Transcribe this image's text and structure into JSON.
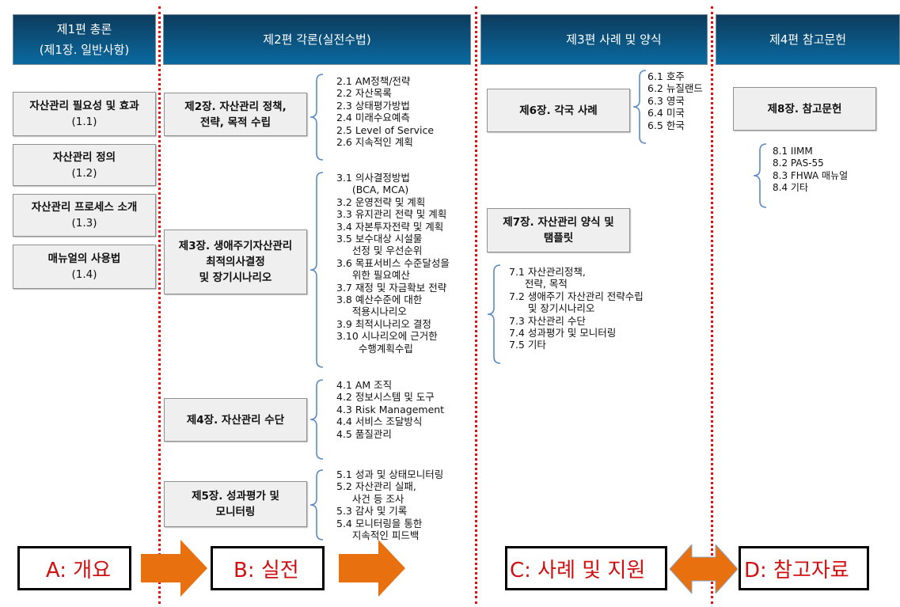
{
  "headers": [
    {
      "line1": "제1편 총론",
      "line2": "(제1장. 일반사항)"
    },
    {
      "line1": "제2편 각론(실전수법)"
    },
    {
      "line1": "제3편 사례 및 양식"
    },
    {
      "line1": "제4편 참고문헌"
    }
  ],
  "part1": {
    "boxes": [
      {
        "title": "자산관리 필요성 및 효과",
        "num": "(1.1)"
      },
      {
        "title": "자산관리 정의",
        "num": "(1.2)"
      },
      {
        "title": "자산관리 프로세스 소개",
        "num": "(1.3)"
      },
      {
        "title": "매뉴얼의 사용법",
        "num": "(1.4)"
      }
    ]
  },
  "part2": {
    "chapters": [
      {
        "title": "제2장. 자산관리 정책,\n전략, 목적 수립",
        "items": "2.1 AM정책/전략\n2.2 자산목록\n2.3 상태평가방법\n2.4 미래수요예측\n2.5 Level of Service\n2.6 지속적인 계획"
      },
      {
        "title": "제3장. 생애주기자산관리\n최적의사결정\n및 장기시나리오",
        "items": "3.1 의사결정방법\n     (BCA, MCA)\n3.2 운영전략 및 계획\n3.3 유지관리 전략 및 계획\n3.4 자본투자전략 및 계획\n3.5 보수대상 시설물\n     선정 및 우선순위\n3.6 목표서비스 수준달성을\n     위한 필요예산\n3.7 재정 및 자금확보 전략\n3.8 예산수준에 대한\n     적용시나리오\n3.9 최적시나리오 결정\n3.10 시나리오에 근거한\n       수행계획수립"
      },
      {
        "title": "제4장. 자산관리 수단",
        "items": "4.1 AM 조직\n4.2 정보시스템 및 도구\n4.3 Risk Management\n4.4 서비스 조달방식\n4.5 품질관리"
      },
      {
        "title": "제5장. 성과평가 및\n모니터링",
        "items": "5.1 성과 및 상태모니터링\n5.2 자산관리 실패,\n     사건 등 조사\n5.3 감사 및 기록\n5.4 모니터링을 통한\n     지속적인 피드백"
      }
    ]
  },
  "part3": {
    "chapters": [
      {
        "title": "제6장. 각국 사례",
        "items": "6.1 호주\n6.2 뉴질랜드\n6.3 영국\n6.4 미국\n6.5 한국"
      },
      {
        "title": "제7장. 자산관리 양식 및\n탬플릿",
        "items": "7.1 자산관리정책,\n     전략, 목적\n7.2 생애주기 자산관리 전략수립\n      및 장기시나리오\n7.3 자산관리 수단\n7.4 성과평가 및 모니터링\n7.5 기타"
      }
    ]
  },
  "part4": {
    "chapters": [
      {
        "title": "제8장. 참고문헌",
        "items": "8.1 IIMM\n8.2 PAS-55\n8.3 FHWA 매뉴얼\n8.4 기타"
      }
    ]
  },
  "flow": {
    "labels": [
      "A: 개요",
      "B: 실전",
      "C: 사례 및 지원",
      "D: 참고자료"
    ],
    "arrow_color": "#e8700f",
    "label_color": "#d01010"
  }
}
